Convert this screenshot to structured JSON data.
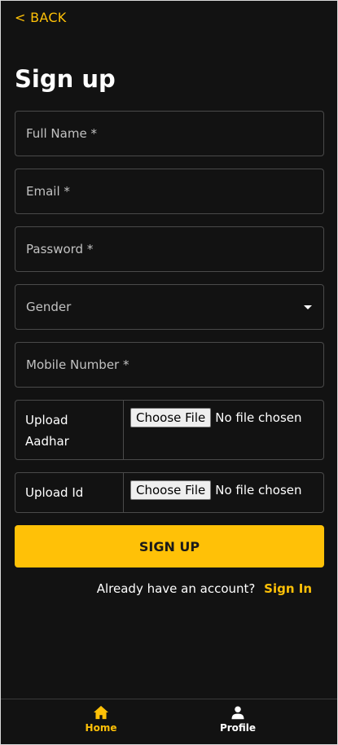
{
  "header": {
    "back_label": "< BACK",
    "title": "Sign up"
  },
  "form": {
    "full_name": {
      "placeholder": "Full Name *",
      "value": ""
    },
    "email": {
      "placeholder": "Email *",
      "value": ""
    },
    "password": {
      "placeholder": "Password *",
      "value": ""
    },
    "gender": {
      "selected": "Gender"
    },
    "mobile": {
      "placeholder": "Mobile Number *",
      "value": ""
    },
    "upload_aadhar": {
      "label": "Upload Aadhar",
      "button": "Choose File",
      "status": "No file chosen"
    },
    "upload_id": {
      "label": "Upload Id",
      "button": "Choose File",
      "status": "No file chosen"
    },
    "submit_label": "SIGN UP"
  },
  "signin": {
    "prompt": "Already have an account?",
    "link": "Sign In"
  },
  "bottom_nav": {
    "items": [
      {
        "label": "Home",
        "icon": "home-icon",
        "active": true
      },
      {
        "label": "Profile",
        "icon": "person-icon",
        "active": false
      }
    ]
  },
  "colors": {
    "accent": "#ffc107",
    "background": "#121212",
    "border": "#4a4a4a"
  }
}
